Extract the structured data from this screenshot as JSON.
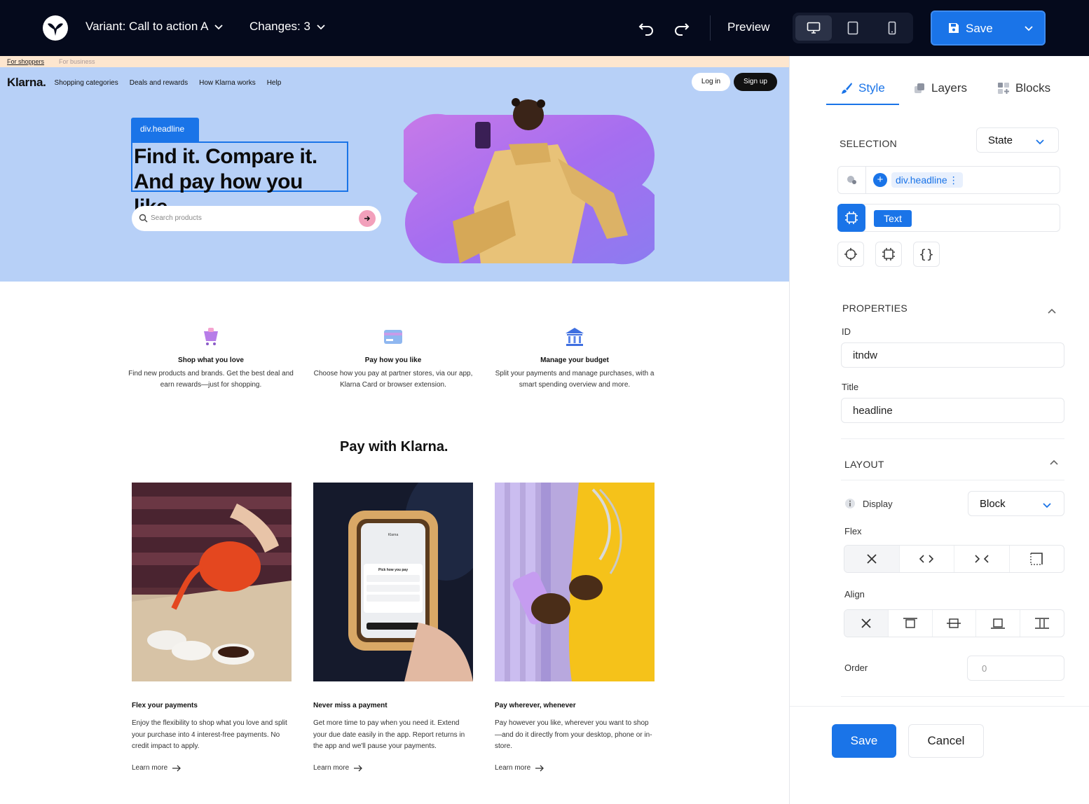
{
  "topbar": {
    "variant_label": "Variant: Call to action A",
    "changes_label": "Changes: 3",
    "preview_label": "Preview",
    "save_label": "Save",
    "accent": "#1a74e8",
    "background": "#050a1c"
  },
  "site": {
    "strip": {
      "shoppers": "For shoppers",
      "business": "For business"
    },
    "brand": "Klarna.",
    "nav": [
      "Shopping categories",
      "Deals and rewards",
      "How Klarna works",
      "Help"
    ],
    "login": "Log in",
    "signup": "Sign up",
    "selection_tag": "div.headline",
    "headline_line1": "Find it. Compare it.",
    "headline_line2": "And pay how you like.",
    "search_placeholder": "Search products",
    "features": [
      {
        "icon": "shopping-cart-icon",
        "title": "Shop what you love",
        "desc": "Find new products and brands. Get the best deal and earn rewards—just for shopping."
      },
      {
        "icon": "credit-card-icon",
        "title": "Pay how you like",
        "desc": "Choose how you pay at partner stores, via our app, Klarna Card or browser extension."
      },
      {
        "icon": "bank-icon",
        "title": "Manage your budget",
        "desc": "Split your payments and manage purchases, with a smart spending overview and more."
      }
    ],
    "pay_title": "Pay with Klarna.",
    "cards": [
      {
        "title": "Flex your payments",
        "desc": "Enjoy the flexibility to shop what you love and split your purchase into 4 interest-free payments. No credit impact to apply.",
        "link": "Learn more"
      },
      {
        "title": "Never miss a payment",
        "desc": "Get more time to pay when you need it. Extend your due date easily in the app. Report returns in the app and we'll pause your payments.",
        "link": "Learn more"
      },
      {
        "title": "Pay wherever, whenever",
        "desc": "Pay however you like, wherever you want to shop—and do it directly from your desktop, phone or in-store.",
        "link": "Learn more"
      }
    ],
    "phone_screen": {
      "app": "Klarna",
      "heading": "Pick how you pay"
    }
  },
  "panel": {
    "tabs": [
      "Style",
      "Layers",
      "Blocks"
    ],
    "selection_heading": "SELECTION",
    "state_label": "State",
    "selector_chip": "div.headline",
    "text_badge": "Text",
    "properties_heading": "PROPERTIES",
    "id_label": "ID",
    "id_value": "itndw",
    "title_label": "Title",
    "title_value": "headline",
    "layout_heading": "LAYOUT",
    "display_label": "Display",
    "display_value": "Block",
    "flex_label": "Flex",
    "align_label": "Align",
    "order_label": "Order",
    "order_placeholder": "0",
    "save_label": "Save",
    "cancel_label": "Cancel"
  }
}
